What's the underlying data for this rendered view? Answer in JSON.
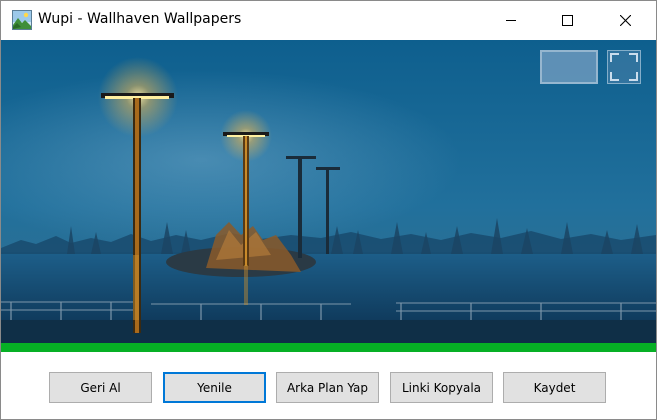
{
  "window": {
    "title": "Wupi - Wallhaven Wallpapers",
    "app_icon": "landscape-picture-icon",
    "controls": [
      "minimize-icon",
      "maximize-icon",
      "close-icon"
    ]
  },
  "wallpaper": {
    "description_icon": "wallpaper-image",
    "overlay_buttons": [
      "fit-wallpaper-icon",
      "fullscreen-icon"
    ]
  },
  "progress": {
    "value": 1.0,
    "color": "#06b025"
  },
  "buttons": {
    "undo": "Geri Al",
    "refresh": "Yenile",
    "set_background": "Arka Plan Yap",
    "copy_link": "Linki Kopyala",
    "save": "Kaydet"
  },
  "colors": {
    "focus_border": "#0078d7",
    "button_face": "#e1e1e1"
  }
}
